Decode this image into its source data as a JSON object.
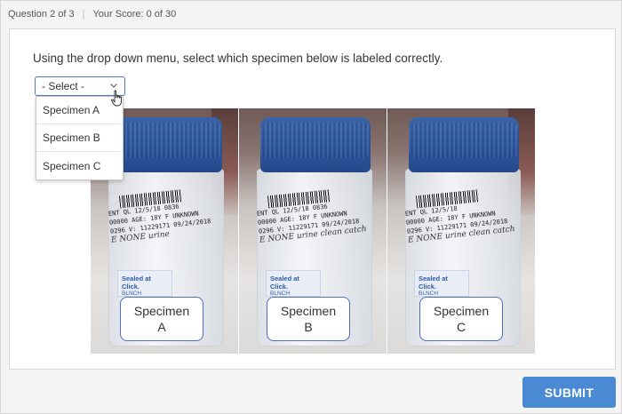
{
  "header": {
    "question": "Question 2 of 3",
    "score": "Your Score: 0 of 30"
  },
  "prompt": "Using the drop down menu, select which specimen below is labeled correctly.",
  "select": {
    "value": "- Select -",
    "options": [
      "Specimen A",
      "Specimen B",
      "Specimen C"
    ]
  },
  "specimens": [
    {
      "line1": "Specimen",
      "line2": "A",
      "label_lines": [
        "ENT QL 12/5/18 0836",
        "00000 AGE: 18Y F UNKNOWN",
        "0296 V: 11229171 09/24/2018",
        "E NONE urine"
      ],
      "sealed_title": "Sealed at Click.",
      "sealed_sub": "BLNCH"
    },
    {
      "line1": "Specimen",
      "line2": "B",
      "label_lines": [
        "ENT QL 12/5/18 0836",
        "00000 AGE: 18Y F UNKNOWN",
        "0296 V: 11229171 09/24/2018",
        "E NONE urine clean catch"
      ],
      "sealed_title": "Sealed at Click.",
      "sealed_sub": "BLNCH"
    },
    {
      "line1": "Specimen",
      "line2": "C",
      "label_lines": [
        "ENT QL 12/5/18",
        "00000 AGE: 18Y F UNKNOWN",
        "0296 V: 11229171 09/24/2018",
        "E NONE urine clean catch"
      ],
      "sealed_title": "Sealed at Click.",
      "sealed_sub": "BLNCH"
    }
  ],
  "submit_label": "SUBMIT",
  "colors": {
    "accent": "#4a8ad4",
    "select_border": "#4a78c2",
    "lid_blue": "#2c57a0"
  }
}
